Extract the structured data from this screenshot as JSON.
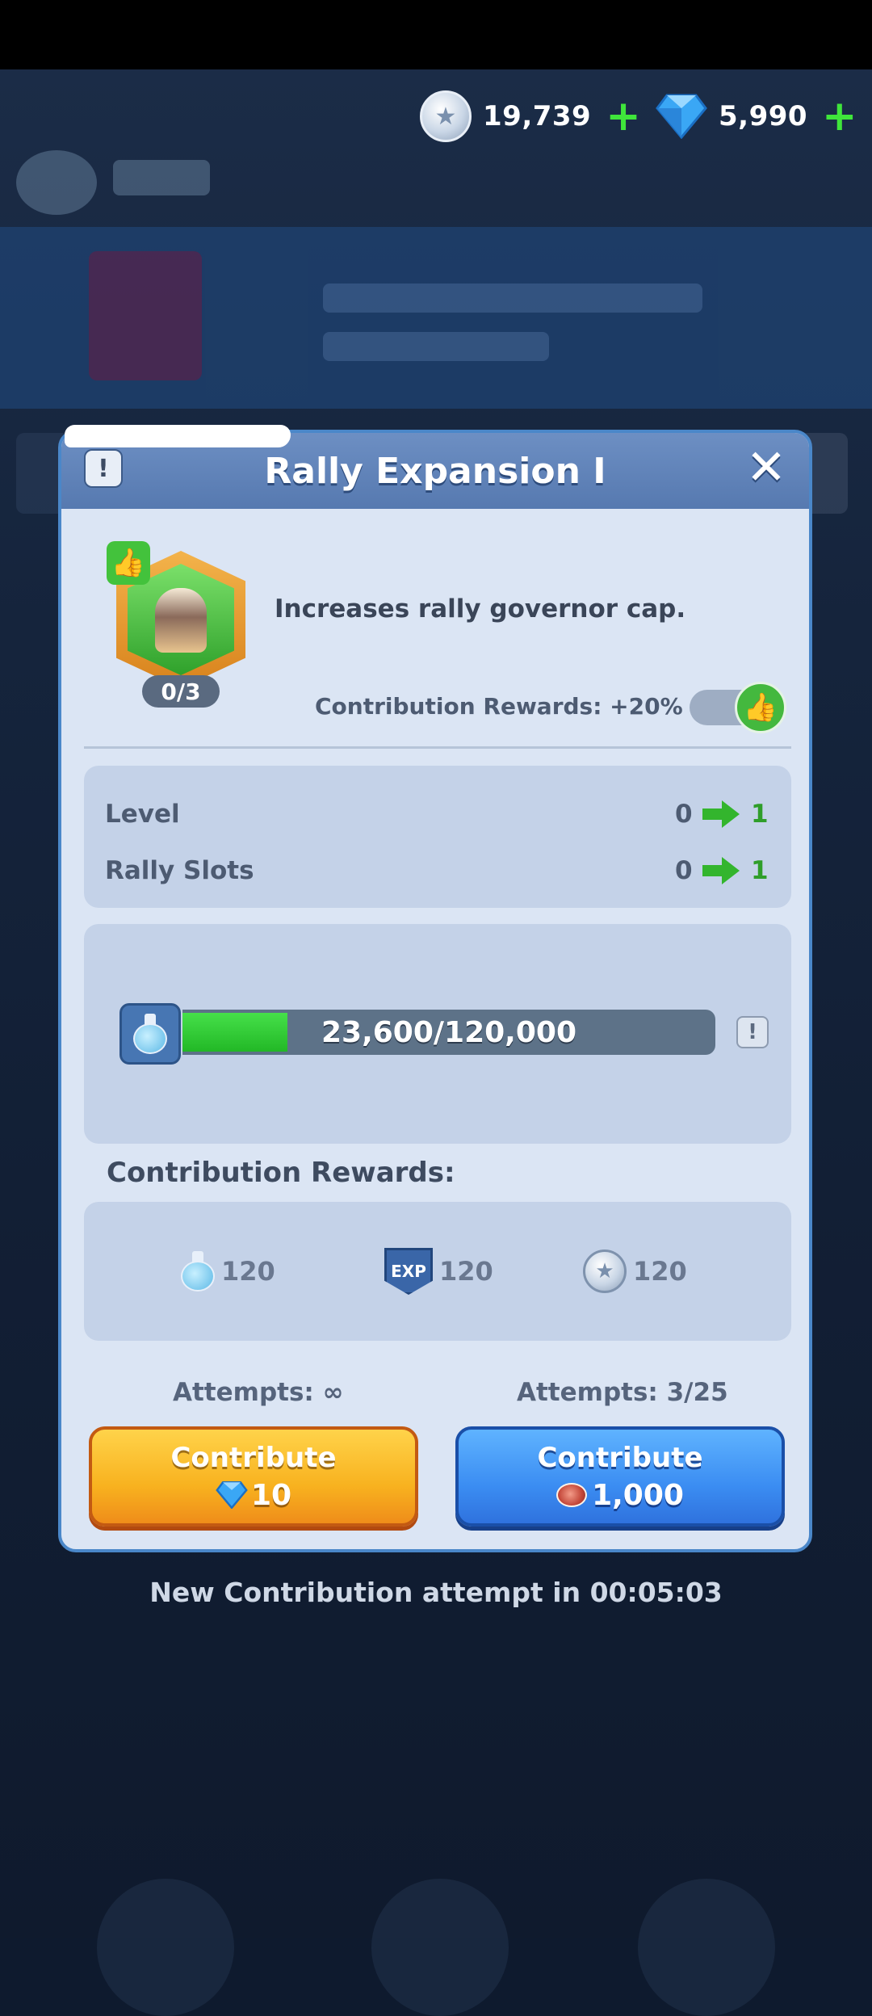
{
  "currencies": {
    "silver": {
      "amount": "19,739",
      "plus": "+"
    },
    "gems": {
      "amount": "5,990",
      "plus": "+"
    }
  },
  "modal": {
    "title": "Rally Expansion I",
    "info_glyph": "!",
    "close_glyph": "✕",
    "badge_count": "0/3",
    "description": "Increases rally governor cap.",
    "contribution_rewards_label": "Contribution Rewards: +20%",
    "toggle_on": true,
    "stats": [
      {
        "label": "Level",
        "from": "0",
        "to": "1"
      },
      {
        "label": "Rally Slots",
        "from": "0",
        "to": "1"
      }
    ],
    "progress": {
      "text": "23,600/120,000",
      "current": 23600,
      "max": 120000
    },
    "progress_info_glyph": "!",
    "rewards_title": "Contribution Rewards:",
    "rewards": [
      {
        "icon": "potion-icon",
        "value": "120"
      },
      {
        "icon": "exp-icon",
        "value": "120",
        "icon_text": "EXP"
      },
      {
        "icon": "silver-coin-icon",
        "value": "120"
      }
    ],
    "gem_option": {
      "attempts": "Attempts: ∞",
      "label": "Contribute",
      "cost": "10"
    },
    "meat_option": {
      "attempts": "Attempts: 3/25",
      "label": "Contribute",
      "cost": "1,000"
    }
  },
  "footer": {
    "timer_text": "New Contribution attempt in 00:05:03"
  },
  "colors": {
    "modal_bg": "#dbe5f4",
    "header": "#6d8fc3",
    "gold_button": "#f8b21f",
    "blue_button": "#3b8df2",
    "progress_fill": "#22b826"
  }
}
